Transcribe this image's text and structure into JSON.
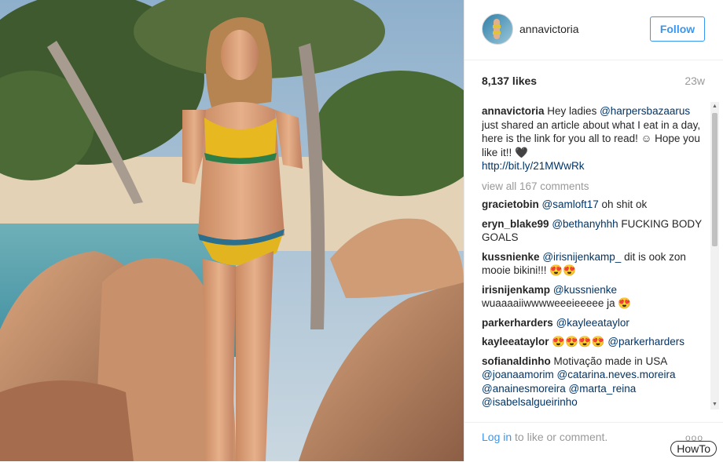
{
  "post": {
    "username": "annavictoria",
    "follow_label": "Follow",
    "likes": "8,137 likes",
    "time": "23w"
  },
  "caption": {
    "username": "annavictoria",
    "text_1": " Hey ladies ",
    "mention": "@harpersbazaarus",
    "text_2": " just shared an article about what I eat in a day, here is the link for you all to read! ☺ Hope you like it!! 🖤",
    "link": "http://bit.ly/21MWwRk"
  },
  "view_all": "view all 167 comments",
  "comments": [
    {
      "user": "gracietobin",
      "mention": "@samloft17",
      "text": " oh shit ok"
    },
    {
      "user": "eryn_blake99",
      "mention": "@bethanyhhh",
      "text": " FUCKING BODY GOALS"
    },
    {
      "user": "kussnienke",
      "mention": "@irisnijenkamp_",
      "text": " dit is ook zon mooie bikini!!! 😍😍"
    },
    {
      "user": "irisnijenkamp",
      "mention": "@kussnienke",
      "text": " wuaaaaiiwwwweeeieeeee ja 😍"
    },
    {
      "user": "parkerharders",
      "mention": "@kayleeataylor",
      "text": ""
    },
    {
      "user": "kayleeataylor",
      "pre": " 😍😍😍😍 ",
      "mention": "@parkerharders",
      "text": ""
    },
    {
      "user": "sofianaldinho",
      "text": " Motivação made in USA ",
      "mentions": "@joanaamorim @catarina.neves.moreira @anainesmoreira @marta_reina @isabelsalgueirinho"
    }
  ],
  "footer": {
    "login_link": "Log in",
    "login_rest": " to like or comment.",
    "more": "ooo"
  },
  "watermark": "HowTo",
  "colors": {
    "accent": "#3897f0",
    "mention": "#003569",
    "muted": "#999999"
  }
}
